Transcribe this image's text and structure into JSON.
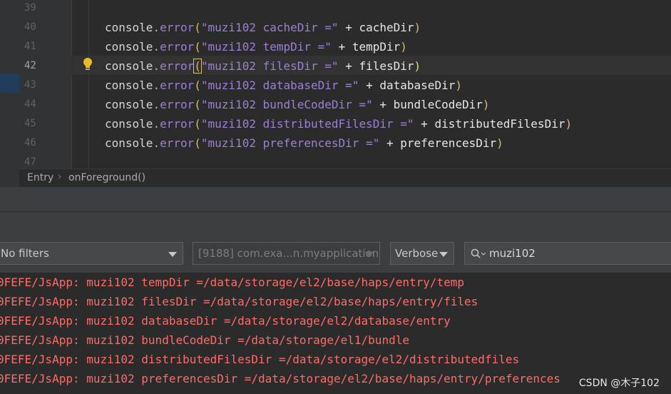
{
  "editor": {
    "line_numbers": [
      "39",
      "40",
      "41",
      "42",
      "43",
      "44",
      "45",
      "46",
      "47"
    ],
    "current_line": "42",
    "code_lines": [
      {
        "obj": "console",
        "method": "error",
        "label": "\"muzi102 cacheDir =\"",
        "plus": "+",
        "var": "cacheDir"
      },
      {
        "obj": "console",
        "method": "error",
        "label": "\"muzi102 tempDir =\"",
        "plus": "+",
        "var": "tempDir"
      },
      {
        "obj": "console",
        "method": "error",
        "label": "\"muzi102 filesDir =\"",
        "plus": "+",
        "var": "filesDir"
      },
      {
        "obj": "console",
        "method": "error",
        "label": "\"muzi102 databaseDir =\"",
        "plus": "+",
        "var": "databaseDir"
      },
      {
        "obj": "console",
        "method": "error",
        "label": "\"muzi102 bundleCodeDir =\"",
        "plus": "+",
        "var": "bundleCodeDir"
      },
      {
        "obj": "console",
        "method": "error",
        "label": "\"muzi102 distributedFilesDir =\"",
        "plus": "+",
        "var": "distributedFilesDir"
      },
      {
        "obj": "console",
        "method": "error",
        "label": "\"muzi102 preferencesDir =\"",
        "plus": "+",
        "var": "preferencesDir"
      }
    ],
    "bulb_icon": "lightbulb-icon"
  },
  "breadcrumb": {
    "items": [
      "Entry",
      "onForeground()"
    ],
    "separator_icon": "chevron-right-icon"
  },
  "log_filters": {
    "level_filter": "No filters",
    "process_filter": "[9188] com.exa...n.myapplication",
    "log_level": "Verbose",
    "search_value": "muzi102",
    "search_icon": "search-icon"
  },
  "log_lines": [
    "0FEFE/JsApp: muzi102 tempDir =/data/storage/el2/base/haps/entry/temp",
    "0FEFE/JsApp: muzi102 filesDir =/data/storage/el2/base/haps/entry/files",
    "0FEFE/JsApp: muzi102 databaseDir =/data/storage/el2/database/entry",
    "0FEFE/JsApp: muzi102 bundleCodeDir =/data/storage/el1/bundle",
    "0FEFE/JsApp: muzi102 distributedFilesDir =/data/storage/el2/distributedfiles",
    "0FEFE/JsApp: muzi102 preferencesDir =/data/storage/el2/base/haps/entry/preferences"
  ],
  "watermark": "CSDN @木子102",
  "colors": {
    "editor_bg": "#2b2b2b",
    "error_text": "#ff6b68",
    "string": "#9e7fd6",
    "paren": "#d8bd70"
  }
}
